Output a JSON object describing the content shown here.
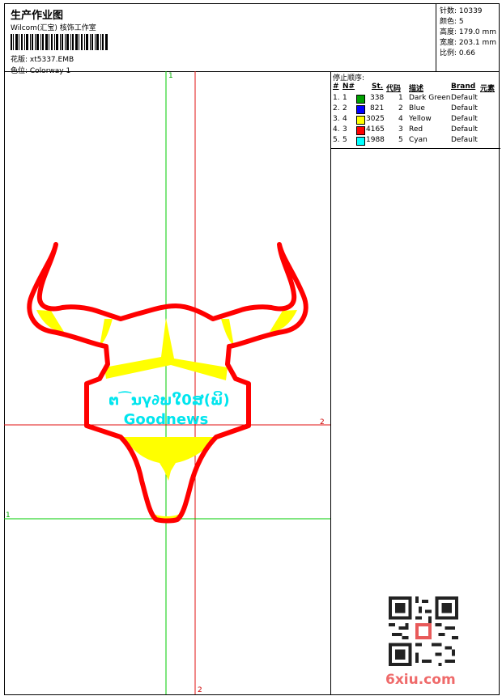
{
  "header": {
    "title": "生产作业图",
    "studio": "Wilcom(汇宝) 核饰工作室",
    "design_file": "花版: xt5337.EMB",
    "colorway": "色位: Colorway 1"
  },
  "stats": {
    "stitches": "针数: 10339",
    "colors": "颜色: 5",
    "height": "高度: 179.0 mm",
    "width": "宽度: 203.1 mm",
    "scale": "比例: 0.66"
  },
  "canvas": {
    "guide_labels": {
      "v1": "1",
      "h1": "1",
      "v2": "2",
      "h2": "2"
    },
    "guide_colors": {
      "green": "#00cc00",
      "red": "#e01010"
    },
    "text_line_1": "ຕ⁀ນγ∂ພໃ0ສ(ພິ)",
    "text_line_2": "Goodnews"
  },
  "stop_sequence": {
    "label": "停止顺序:",
    "headers": {
      "num": "#",
      "needle": "N#",
      "stitches": "St.",
      "code": "代码",
      "description": "描述",
      "brand": "Brand",
      "element": "元素"
    },
    "rows": [
      {
        "num": "1.",
        "needle": "1",
        "color": "#00a000",
        "stitches": "338",
        "code": "1",
        "description": "Dark Green",
        "brand": "Default"
      },
      {
        "num": "2.",
        "needle": "2",
        "color": "#0000ff",
        "stitches": "821",
        "code": "2",
        "description": "Blue",
        "brand": "Default"
      },
      {
        "num": "3.",
        "needle": "4",
        "color": "#ffff00",
        "stitches": "3025",
        "code": "4",
        "description": "Yellow",
        "brand": "Default"
      },
      {
        "num": "4.",
        "needle": "3",
        "color": "#ff0000",
        "stitches": "4165",
        "code": "3",
        "description": "Red",
        "brand": "Default"
      },
      {
        "num": "5.",
        "needle": "5",
        "color": "#00ffff",
        "stitches": "1988",
        "code": "5",
        "description": "Cyan",
        "brand": "Default"
      }
    ]
  },
  "watermark": {
    "site": "6xiu.com"
  },
  "colors": {
    "red": "#ff0000",
    "yellow": "#ffff00",
    "cyan": "#00e5ee",
    "watermark": "#ef6a6a"
  }
}
